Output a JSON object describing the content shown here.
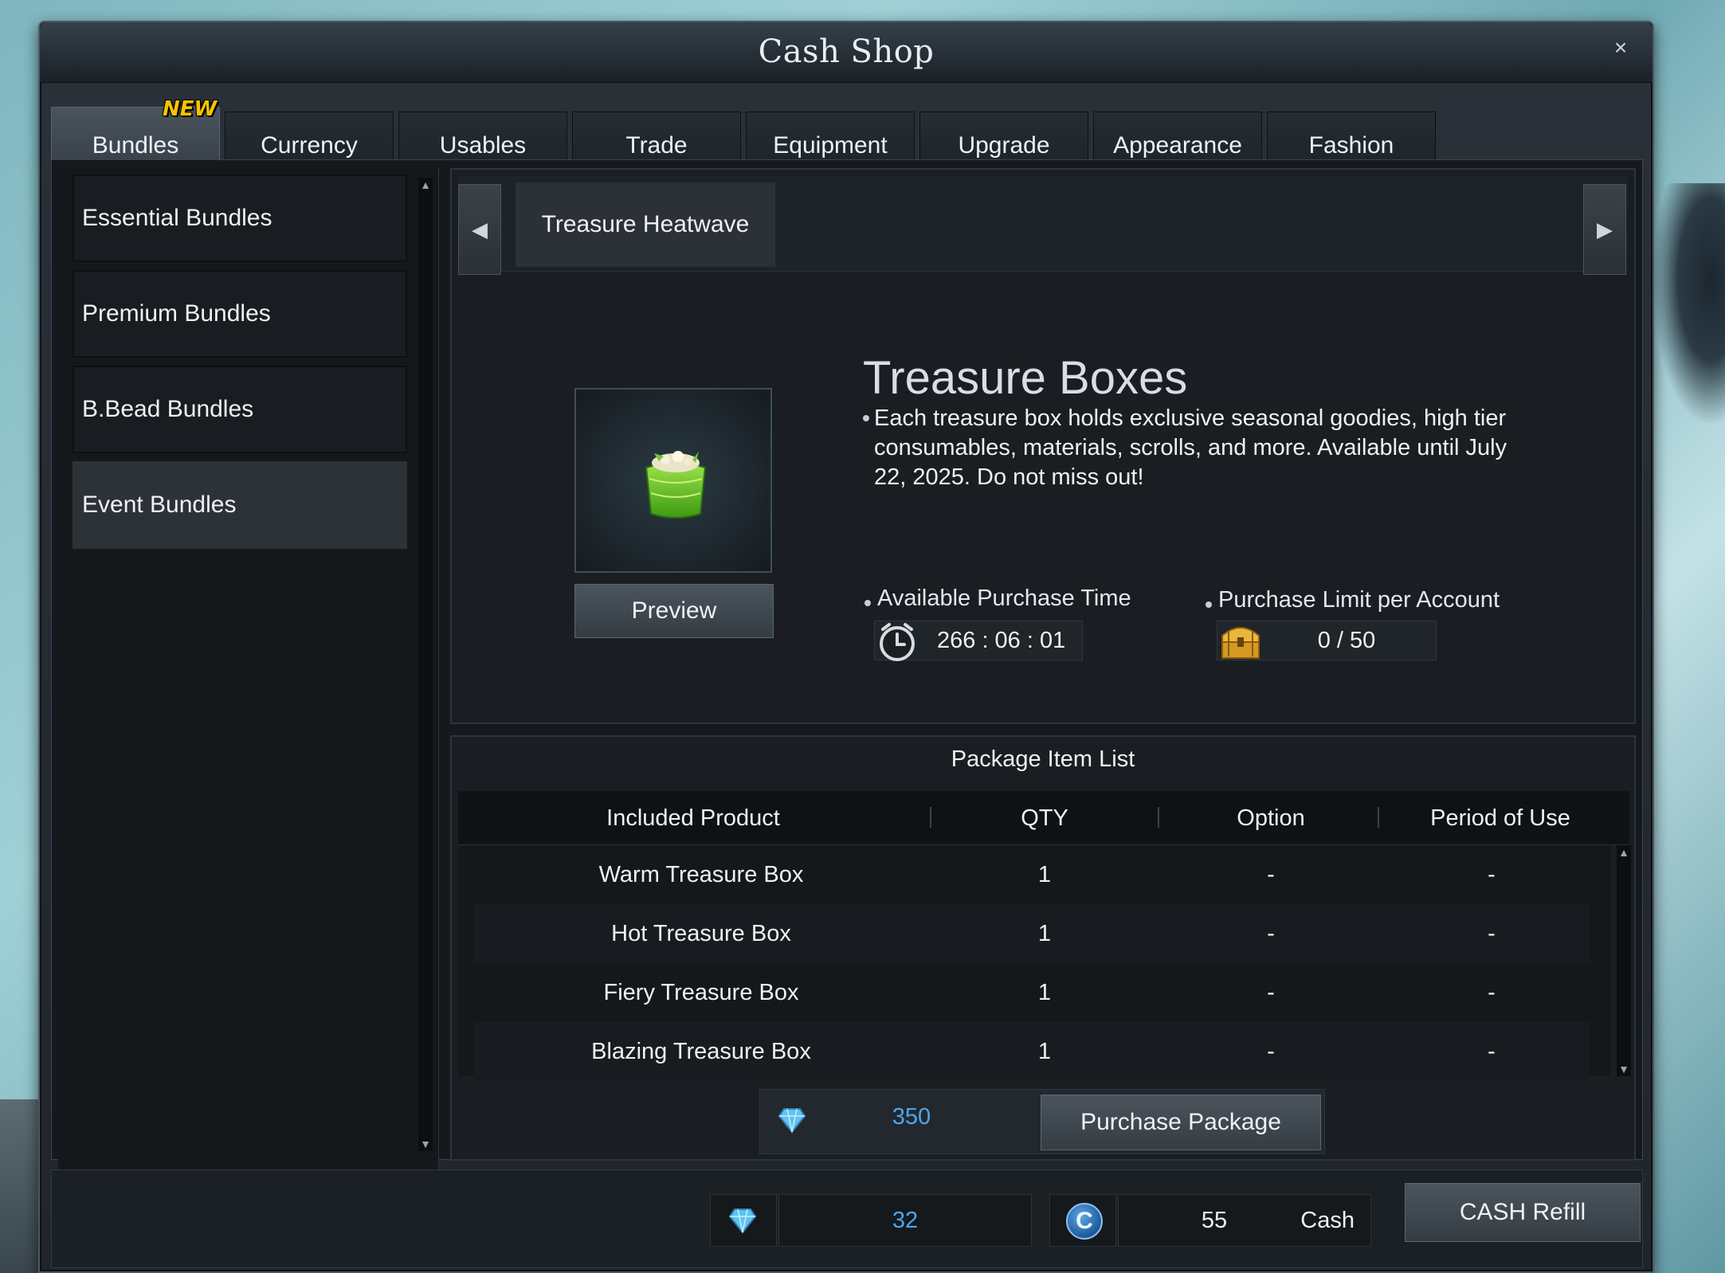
{
  "window": {
    "title": "Cash Shop",
    "close_label": "×"
  },
  "tabs": {
    "new_badge": "NEW",
    "items": [
      {
        "label": "Bundles"
      },
      {
        "label": "Currency"
      },
      {
        "label": "Usables"
      },
      {
        "label": "Trade"
      },
      {
        "label": "Equipment"
      },
      {
        "label": "Upgrade"
      },
      {
        "label": "Appearance"
      },
      {
        "label": "Fashion"
      }
    ],
    "active": "Bundles"
  },
  "sidebar": {
    "items": [
      {
        "label": "Essential Bundles"
      },
      {
        "label": "Premium Bundles"
      },
      {
        "label": "B.Bead Bundles"
      },
      {
        "label": "Event Bundles"
      }
    ],
    "active": "Event Bundles"
  },
  "event_tabs": {
    "items": [
      {
        "label": "Treasure Heatwave"
      }
    ]
  },
  "product": {
    "title": "Treasure Boxes",
    "description": "Each treasure box holds exclusive seasonal goodies, high tier consumables, materials, scrolls, and more. Available until July 22, 2025. Do not miss out!",
    "preview_label": "Preview",
    "purchase_time_label": "Available Purchase Time",
    "purchase_time_value": "266 : 06 : 01",
    "purchase_limit_label": "Purchase Limit per Account",
    "purchase_limit_value": "0 / 50",
    "icons": {
      "item": "green-treasure-box-icon",
      "clock": "alarm-clock-icon",
      "chest": "treasure-chest-icon"
    }
  },
  "package": {
    "title": "Package Item List",
    "columns": [
      "Included Product",
      "QTY",
      "Option",
      "Period of Use"
    ],
    "rows": [
      {
        "product": "Warm Treasure Box",
        "qty": "1",
        "option": "-",
        "period": "-"
      },
      {
        "product": "Hot Treasure Box",
        "qty": "1",
        "option": "-",
        "period": "-"
      },
      {
        "product": "Fiery Treasure Box",
        "qty": "1",
        "option": "-",
        "period": "-"
      },
      {
        "product": "Blazing Treasure Box",
        "qty": "1",
        "option": "-",
        "period": "-"
      }
    ],
    "price": "350",
    "purchase_label": "Purchase Package"
  },
  "footer": {
    "gems": "32",
    "cash_icon_letter": "C",
    "cash": "55",
    "cash_label": "Cash",
    "refill_label": "CASH Refill"
  },
  "colors": {
    "accent_blue": "#4da6f0",
    "new_badge": "#f5c400",
    "active_tab": "#4a545d"
  }
}
